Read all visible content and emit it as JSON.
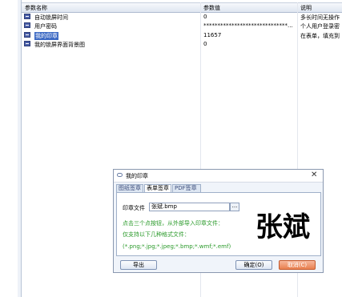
{
  "grid": {
    "columns": [
      "参数名称",
      "参数值",
      "说明"
    ],
    "rows": [
      {
        "name": "自动锁屏时间",
        "value": "0",
        "desc": "多长时间无操作"
      },
      {
        "name": "用户密码",
        "value": "******************************...",
        "desc": "个人用户登录密"
      },
      {
        "name": "我的印章",
        "value": "11657",
        "desc": "在表单，填充到",
        "selected": true
      },
      {
        "name": "我的锁屏界面背景图",
        "value": "0",
        "desc": ""
      }
    ]
  },
  "dialog": {
    "title": "我的印章",
    "close_glyph": "✕",
    "tabs": [
      "图纸签章",
      "表单签章",
      "PDF签章"
    ],
    "active_tab": 1,
    "file_label": "印章文件",
    "file_value": "张斌.bmp",
    "browse_label": "...",
    "hint1": "点击三个点按钮，从外部导入印章文件：",
    "hint2": "仅支持以下几种格式文件：",
    "formats": "(*.png;*.jpg;*.jpeg;*.bmp;*.wmf;*.emf)",
    "stamp_text": "张斌",
    "export_label": "导出",
    "ok_label": "确定(O)",
    "cancel_label": "取消(C)"
  },
  "colors": {
    "selection": "#3d6ac4",
    "hint": "#2a9a2a",
    "cancel": "#e9804f"
  }
}
